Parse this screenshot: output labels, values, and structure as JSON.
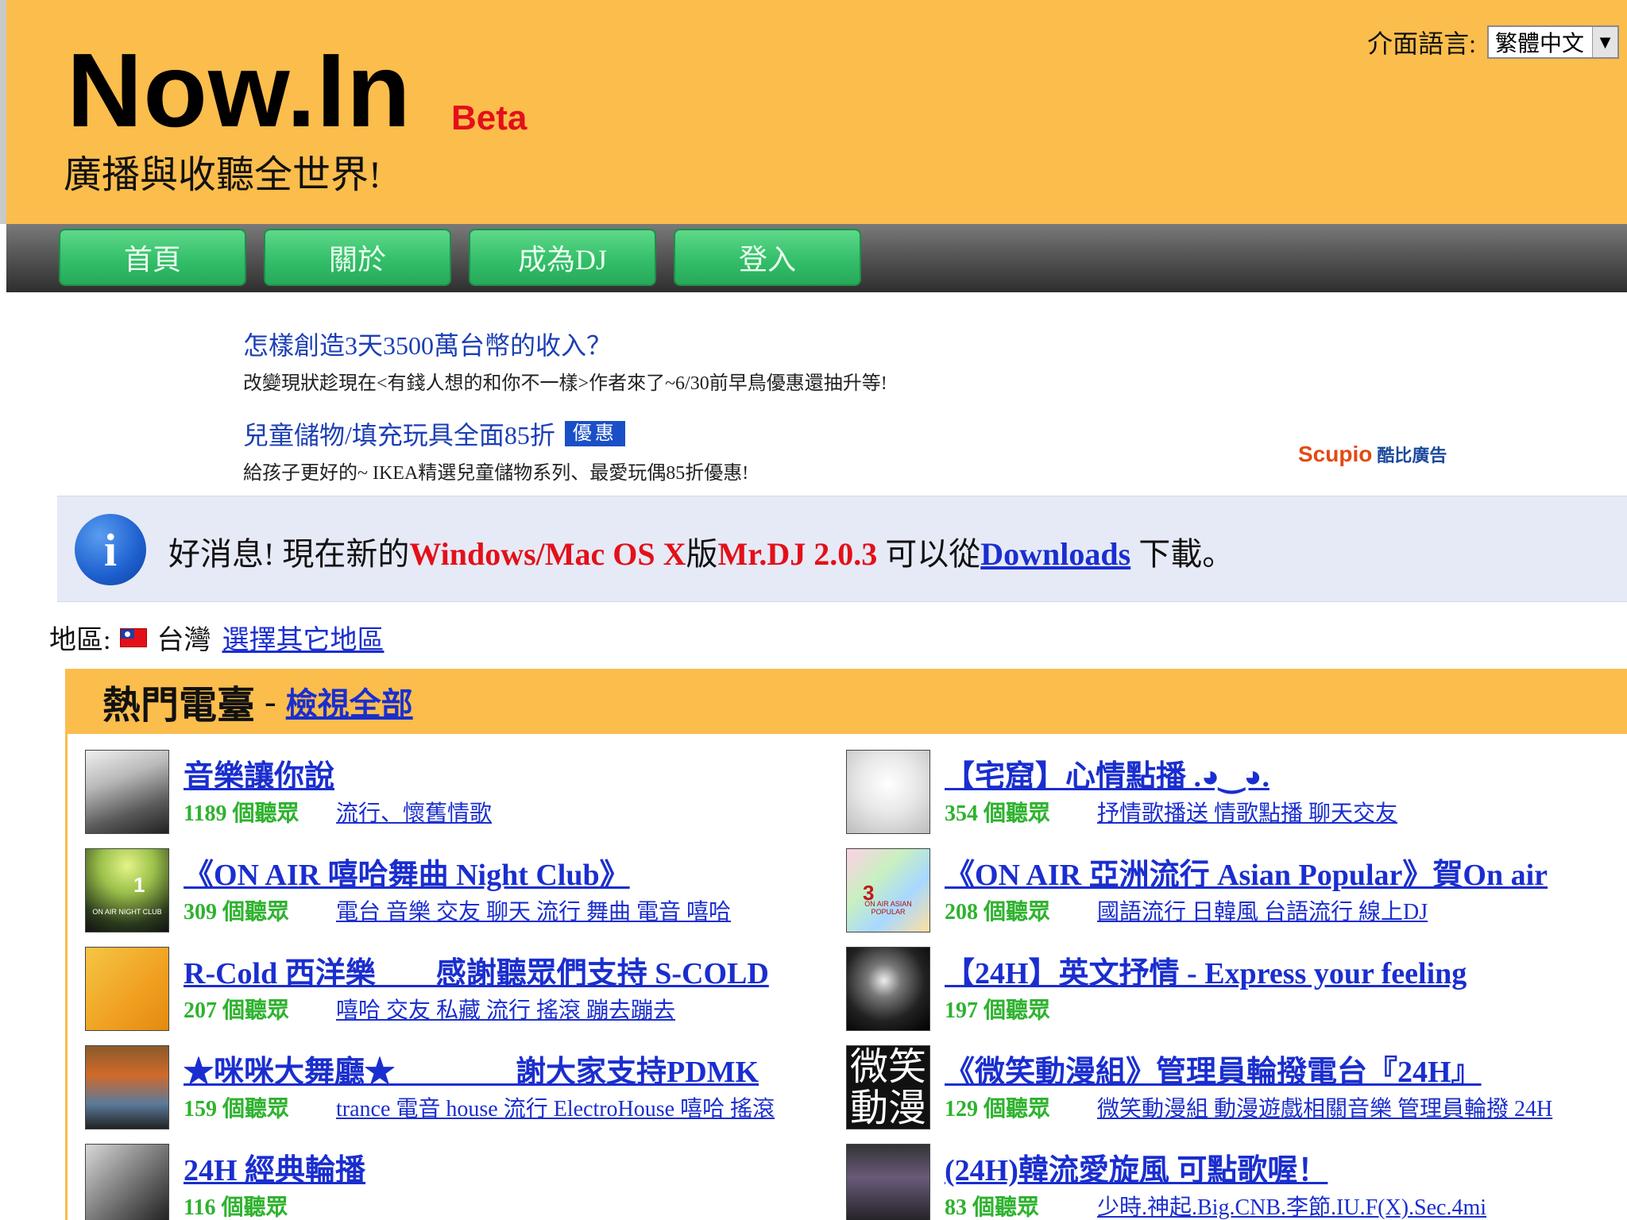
{
  "header": {
    "logo": "Now.In",
    "beta": "Beta",
    "tagline": "廣播與收聽全世界!",
    "language_label": "介面語言:",
    "language_value": "繁體中文"
  },
  "nav": {
    "items": [
      "首頁",
      "關於",
      "成為DJ",
      "登入"
    ]
  },
  "ads": {
    "items": [
      {
        "title": "怎樣創造3天3500萬台幣的收入？",
        "desc": "改變現狀趁現在<有錢人想的和你不一樣>作者來了~6/30前早鳥優惠還抽升等!",
        "badge": ""
      },
      {
        "title": "兒童儲物/填充玩具全面85折",
        "desc": "給孩子更好的~ IKEA精選兒童儲物系列、最愛玩偶85折優惠!",
        "badge": "優惠"
      }
    ],
    "sponsor": "Scupio",
    "sponsor_sub": "酷比廣告"
  },
  "info": {
    "icon": "i",
    "t1": "好消息! 現在新的",
    "t2": "Windows/Mac OS X",
    "t3": "版",
    "t4": "Mr.DJ 2.0.3",
    "t5": " 可以從",
    "t6": "Downloads",
    "t7": " 下載。"
  },
  "region": {
    "label": "地區:",
    "value": "台灣",
    "change": "選擇其它地區"
  },
  "popular": {
    "title": "熱門電臺",
    "dash": "-",
    "view_all": "檢視全部",
    "stations": [
      {
        "name": "音樂讓你說",
        "listeners": "1189 個聽眾",
        "tags": "流行、懷舊情歌",
        "thumb_num": "",
        "thumb_cap": "",
        "thumb_text": ""
      },
      {
        "name": "【宅窟】心情點播 .◕‿◕.",
        "listeners": "354 個聽眾",
        "tags": "抒情歌播送 情歌點播 聊天交友",
        "thumb_num": "",
        "thumb_cap": "",
        "thumb_text": ""
      },
      {
        "name": "《ON AIR 嘻哈舞曲 Night Club》",
        "listeners": "309 個聽眾",
        "tags": "電台 音樂 交友 聊天 流行 舞曲 電音 嘻哈",
        "thumb_num": "1",
        "thumb_cap": "ON AIR NIGHT CLUB",
        "thumb_text": ""
      },
      {
        "name": "《ON AIR 亞洲流行 Asian Popular》賀On air",
        "listeners": "208 個聽眾",
        "tags": "國語流行 日韓風 台語流行 線上DJ",
        "thumb_num": "3",
        "thumb_cap": "ON AIR ASIAN POPULAR",
        "thumb_text": ""
      },
      {
        "name": "R-Cold 西洋樂　　感謝聽眾們支持 S-COLD",
        "listeners": "207 個聽眾",
        "tags": "嘻哈 交友 私藏 流行 搖滾 蹦去蹦去",
        "thumb_num": "",
        "thumb_cap": "",
        "thumb_text": ""
      },
      {
        "name": "【24H】英文抒情 - Express your feeling",
        "listeners": "197 個聽眾",
        "tags": "",
        "thumb_num": "",
        "thumb_cap": "",
        "thumb_text": ""
      },
      {
        "name": "★咪咪大舞廳★　　　　謝大家支持PDMK",
        "listeners": "159 個聽眾",
        "tags": "trance 電音 house 流行 ElectroHouse 嘻哈 搖滾",
        "thumb_num": "",
        "thumb_cap": "",
        "thumb_text": ""
      },
      {
        "name": "《微笑動漫組》管理員輪撥電台『24H』",
        "listeners": "129 個聽眾",
        "tags": "微笑動漫組 動漫遊戲相關音樂 管理員輪撥 24H",
        "thumb_num": "",
        "thumb_cap": "",
        "thumb_text": "微笑動漫"
      },
      {
        "name": "24H 經典輪播",
        "listeners": "116 個聽眾",
        "tags": "",
        "thumb_num": "",
        "thumb_cap": "",
        "thumb_text": ""
      },
      {
        "name": "(24H)韓流愛旋風 可點歌喔！",
        "listeners": "83 個聽眾",
        "tags": "少時.神起.Big.CNB.李節.IU.F(X).Sec.4mi",
        "thumb_num": "",
        "thumb_cap": "",
        "thumb_text": ""
      }
    ]
  },
  "icons": {
    "info": "info-circle-icon",
    "flag": "taiwan-flag-icon",
    "dropdown": "chevron-down-icon"
  },
  "colors": {
    "header_bg": "#fbbd4c",
    "nav_button": "#34bf6a",
    "link": "#1a2ecf",
    "listeners": "#2eb22e",
    "accent_red": "#e3101a"
  }
}
